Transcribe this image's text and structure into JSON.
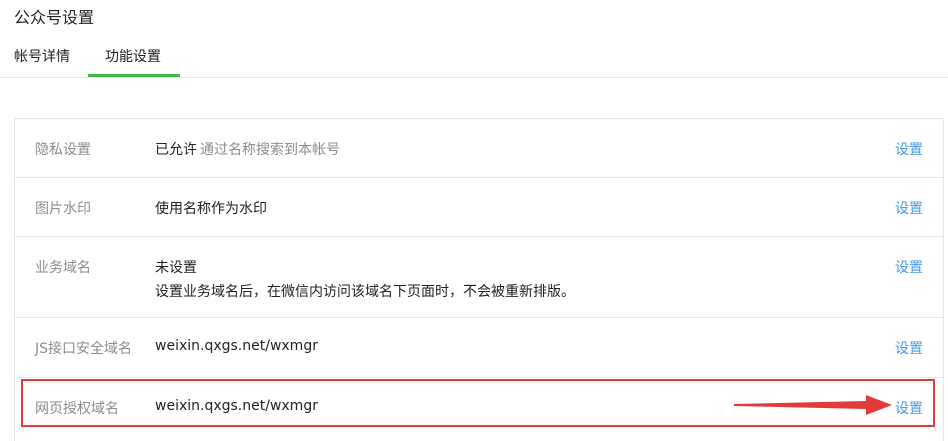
{
  "page": {
    "title": "公众号设置"
  },
  "tabs": [
    {
      "label": "帐号详情",
      "active": false
    },
    {
      "label": "功能设置",
      "active": true
    }
  ],
  "settings": {
    "rows": [
      {
        "label": "隐私设置",
        "value": "已允许",
        "hint": "通过名称搜索到本帐号",
        "action": "设置"
      },
      {
        "label": "图片水印",
        "value": "使用名称作为水印",
        "action": "设置"
      },
      {
        "label": "业务域名",
        "value": "未设置",
        "desc": "设置业务域名后，在微信内访问该域名下页面时，不会被重新排版。",
        "action": "设置"
      },
      {
        "label": "JS接口安全域名",
        "value": "weixin.qxgs.net/wxmgr",
        "action": "设置"
      },
      {
        "label": "网页授权域名",
        "value": "weixin.qxgs.net/wxmgr",
        "action": "设置",
        "highlighted": true
      }
    ]
  },
  "colors": {
    "accent_green": "#44b549",
    "link_blue": "#459ae9",
    "annotation_red": "#e23b3b",
    "border": "#e7e7eb"
  }
}
